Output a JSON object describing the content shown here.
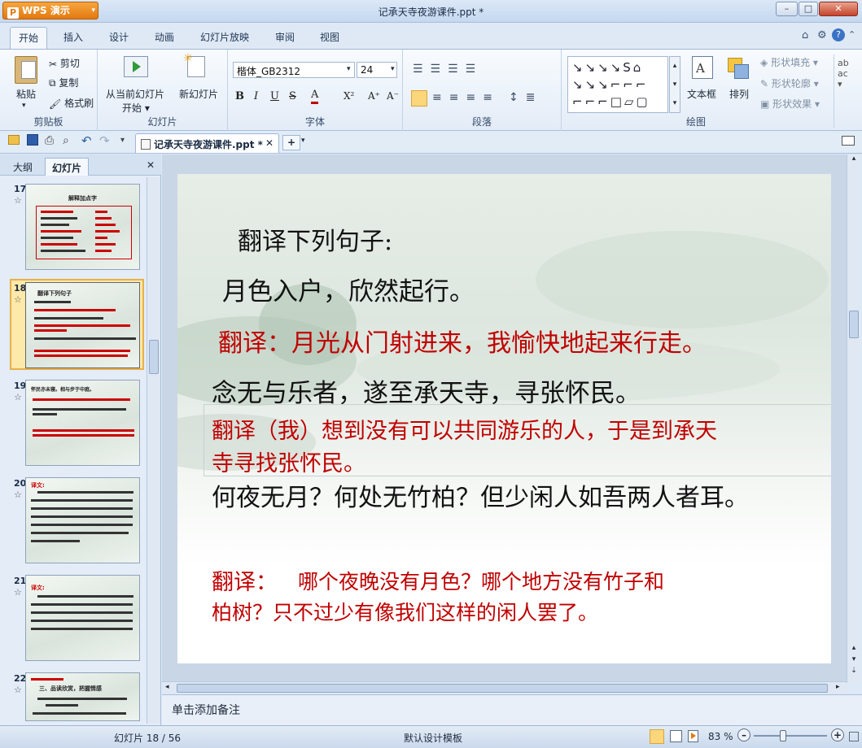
{
  "app": {
    "name": "WPS 演示",
    "title": "记承天寺夜游课件.ppt *"
  },
  "window_controls": {
    "minimize": "–",
    "maximize": "□",
    "close": "✕"
  },
  "ribbon_tabs": [
    "开始",
    "插入",
    "设计",
    "动画",
    "幻灯片放映",
    "审阅",
    "视图"
  ],
  "clipboard": {
    "paste": "粘贴",
    "cut": "剪切",
    "copy": "复制",
    "format_painter": "格式刷",
    "label": "剪贴板"
  },
  "slides_group": {
    "from_current": "从当前幻灯片",
    "start": "开始",
    "new_slide": "新幻灯片",
    "label": "幻灯片"
  },
  "font_group": {
    "font_name": "楷体_GB2312",
    "font_size": "24",
    "label": "字体",
    "bold": "B",
    "italic": "I",
    "underline": "U",
    "strike": "S",
    "font_color": "A",
    "superscript": "X²",
    "grow": "A⁺",
    "shrink": "A⁻"
  },
  "paragraph_group": {
    "label": "段落"
  },
  "drawing_group": {
    "textbox": "文本框",
    "arrange": "排列",
    "shape_fill": "形状填充",
    "shape_outline": "形状轮廓",
    "shape_effect": "形状效果",
    "label": "绘图"
  },
  "doc_tab": {
    "name": "记承天寺夜游课件.ppt *",
    "close": "✕",
    "add": "+"
  },
  "left_panel": {
    "tab_outline": "大纲",
    "tab_slides": "幻灯片",
    "close": "✕"
  },
  "thumbnails": [
    {
      "num": "17",
      "title": "解释加点字"
    },
    {
      "num": "18",
      "title": "翻译下列句子"
    },
    {
      "num": "19",
      "title": "怀民亦未寝。相与步于中庭。"
    },
    {
      "num": "20",
      "title": "译文:"
    },
    {
      "num": "21",
      "title": "译文:"
    },
    {
      "num": "22",
      "title": "三、品读欣赏，把握情感"
    }
  ],
  "slide": {
    "heading": "翻译下列句子:",
    "line1": "月色入户，欣然起行。",
    "trans1": "翻译：月光从门射进来，我愉快地起来行走。",
    "line2": "念无与乐者，遂至承天寺，寻张怀民。",
    "trans2a": "翻译（我）想到没有可以共同游乐的人，于是到承天",
    "trans2b": "寺寻找张怀民。",
    "line3": "何夜无月？何处无竹柏？但少闲人如吾两人者耳。",
    "trans3_label": "翻译：",
    "trans3a": "哪个夜晚没有月色？哪个地方没有竹子和",
    "trans3b": "柏树？只不过少有像我们这样的闲人罢了。"
  },
  "notes_placeholder": "单击添加备注",
  "status": {
    "slide_info": "幻灯片 18 / 56",
    "template": "默认设计模板",
    "zoom": "83 %"
  },
  "colors": {
    "accent_orange": "#e3790f",
    "slide_red": "#c00000",
    "ribbon_blue": "#dfe9f5"
  }
}
